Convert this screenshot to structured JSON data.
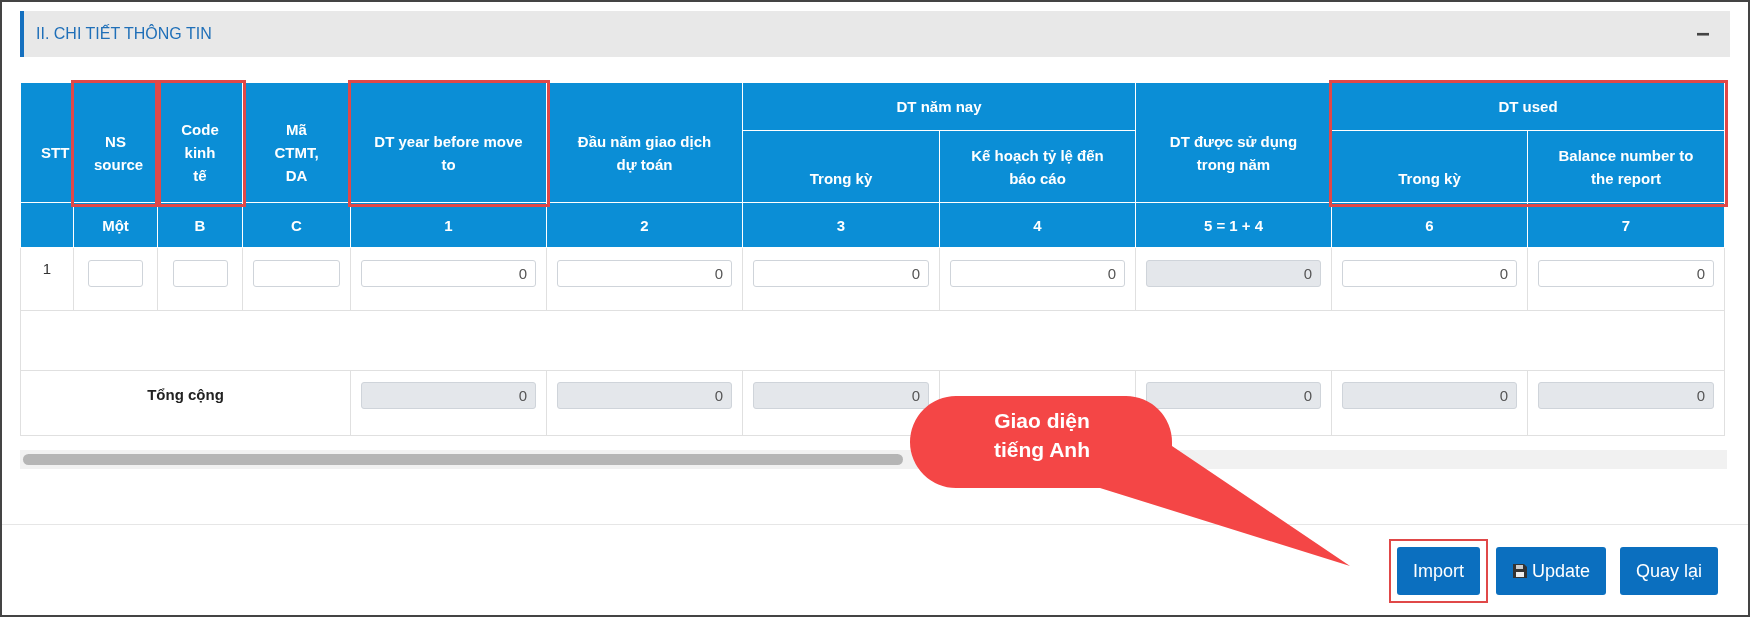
{
  "section": {
    "title": "II. CHI TIẾT THÔNG TIN",
    "collapse_symbol": "−"
  },
  "table": {
    "header_columns": [
      {
        "label": "STT"
      },
      {
        "label": "NS source",
        "highlighted": true
      },
      {
        "label": "Code kinh tế",
        "highlighted": true
      },
      {
        "label": "Mã CTMT, DA"
      },
      {
        "label": "DT year before move to",
        "highlighted": true
      },
      {
        "label": "Đầu năm giao dịch dự toán"
      },
      {
        "label": "DT năm nay",
        "children": [
          {
            "label": "Trong kỳ"
          },
          {
            "label": "Kế hoạch tỷ lệ đến báo cáo"
          }
        ]
      },
      {
        "label": "DT được sử dụng trong năm"
      },
      {
        "label": "DT used",
        "highlighted": true,
        "children": [
          {
            "label": "Trong kỳ"
          },
          {
            "label": "Balance number to the report"
          }
        ]
      }
    ],
    "column_numbers": [
      "Một",
      "B",
      "C",
      "1",
      "2",
      "3",
      "4",
      "5 = 1 + 4",
      "6",
      "7"
    ],
    "rows": [
      {
        "stt": "1",
        "cells": [
          {
            "kind": "input"
          },
          {
            "kind": "input"
          },
          {
            "kind": "input"
          },
          {
            "kind": "input",
            "value": "0",
            "disabled": false
          },
          {
            "kind": "input",
            "value": "0",
            "disabled": false
          },
          {
            "kind": "input",
            "value": "0",
            "disabled": false
          },
          {
            "kind": "input",
            "value": "0",
            "disabled": false
          },
          {
            "kind": "input",
            "value": "0",
            "disabled": true
          },
          {
            "kind": "input",
            "value": "0",
            "disabled": false
          },
          {
            "kind": "input",
            "value": "0",
            "disabled": false
          }
        ]
      }
    ],
    "total": {
      "label": "Tổng cộng",
      "cells": [
        {
          "kind": "input",
          "value": "0",
          "disabled": true
        },
        {
          "kind": "input",
          "value": "0",
          "disabled": true
        },
        {
          "kind": "input",
          "value": "0",
          "disabled": true
        },
        {
          "kind": "covered"
        },
        {
          "kind": "input",
          "value": "0",
          "disabled": true
        },
        {
          "kind": "input",
          "value": "0",
          "disabled": true
        },
        {
          "kind": "input",
          "value": "0",
          "disabled": true
        }
      ]
    }
  },
  "callout": {
    "text": "Giao diện tiếng Anh"
  },
  "buttons": [
    {
      "label": "Import",
      "kind": "plain",
      "highlighted": true
    },
    {
      "label": "Update",
      "kind": "save",
      "highlighted": false
    },
    {
      "label": "Quay lại",
      "kind": "plain",
      "highlighted": false
    }
  ]
}
